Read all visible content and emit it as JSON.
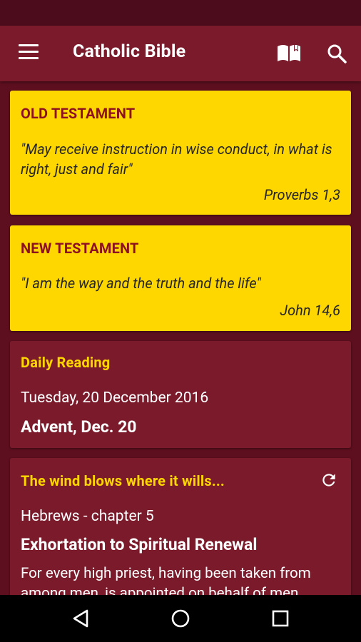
{
  "appbar": {
    "title": "Catholic Bible",
    "icons": [
      "menu-icon",
      "book-icon",
      "search-icon"
    ]
  },
  "old_testament": {
    "heading": "OLD TESTAMENT",
    "quote": "\"May receive instruction in wise conduct, in what is right, just and fair\"",
    "reference": "Proverbs 1,3"
  },
  "new_testament": {
    "heading": "NEW TESTAMENT",
    "quote": "\"I am the way and the truth and the life\"",
    "reference": "John 14,6"
  },
  "daily_reading": {
    "heading": "Daily Reading",
    "date": "Tuesday, 20 December 2016",
    "liturgy": "Advent, Dec. 20"
  },
  "random_reading": {
    "heading": "The wind blows where it wills...",
    "book_chapter": "Hebrews - chapter 5",
    "section_title": "Exhortation to Spiritual Renewal",
    "text": "For every high priest, having been taken from among men, is appointed on behalf of men"
  },
  "navbar": {
    "icons": [
      "back-icon",
      "home-icon",
      "recents-icon"
    ]
  },
  "colors": {
    "primary": "#7a1a2b",
    "primary_dark": "#4d0c1b",
    "background": "#5e0f1f",
    "accent_yellow": "#ffd700",
    "heading_red": "#8c1020"
  }
}
